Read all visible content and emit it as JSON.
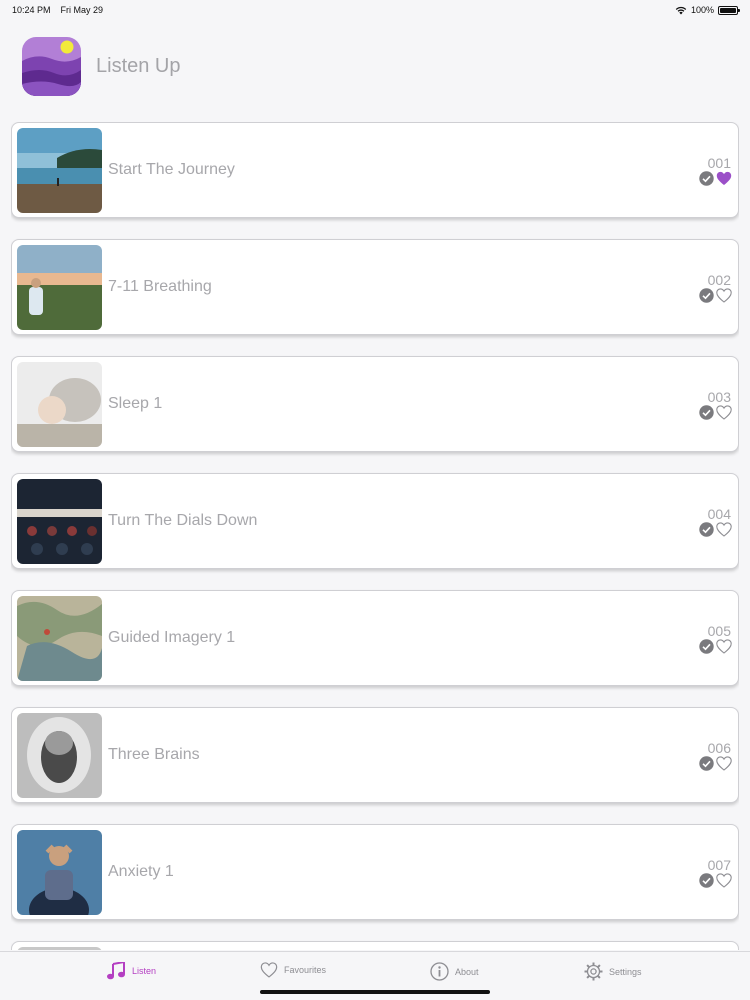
{
  "status": {
    "time": "10:24 PM",
    "date": "Fri May 29",
    "battery": "100%"
  },
  "header": {
    "title": "Listen Up"
  },
  "tracks": [
    {
      "title": "Start The Journey",
      "number": "001",
      "favourite": true
    },
    {
      "title": "7-11 Breathing",
      "number": "002",
      "favourite": false
    },
    {
      "title": "Sleep 1",
      "number": "003",
      "favourite": false
    },
    {
      "title": "Turn The Dials Down",
      "number": "004",
      "favourite": false
    },
    {
      "title": "Guided Imagery 1",
      "number": "005",
      "favourite": false
    },
    {
      "title": "Three Brains",
      "number": "006",
      "favourite": false
    },
    {
      "title": "Anxiety 1",
      "number": "007",
      "favourite": false
    }
  ],
  "tabs": [
    {
      "label": "Listen",
      "icon": "music-note-icon",
      "active": true
    },
    {
      "label": "Favourites",
      "icon": "heart-icon",
      "active": false
    },
    {
      "label": "About",
      "icon": "info-icon",
      "active": false
    },
    {
      "label": "Settings",
      "icon": "gear-icon",
      "active": false
    }
  ],
  "colors": {
    "accent": "#b43fc2",
    "favourite": "#9b4fc8",
    "text": "#a7a7ab"
  }
}
